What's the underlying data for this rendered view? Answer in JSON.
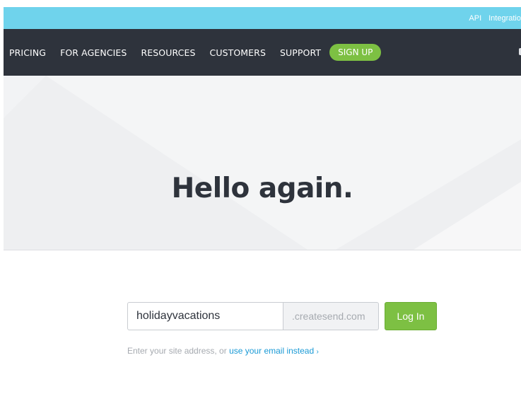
{
  "topbar": {
    "links": [
      "API",
      "Integratio"
    ],
    "background": "#6fd3ec"
  },
  "nav": {
    "items": [
      "PRICING",
      "FOR AGENCIES",
      "RESOURCES",
      "CUSTOMERS",
      "SUPPORT"
    ],
    "signup_label": "SIGN UP",
    "background": "#2e333c",
    "accent": "#7dc043"
  },
  "hero": {
    "title": "Hello again."
  },
  "login": {
    "site_value": "holidayvacations",
    "site_suffix": ".createsend.com",
    "button_label": "Log In",
    "helper_text": "Enter your site address, or ",
    "helper_link": "use your email instead",
    "helper_chevron": "›"
  }
}
